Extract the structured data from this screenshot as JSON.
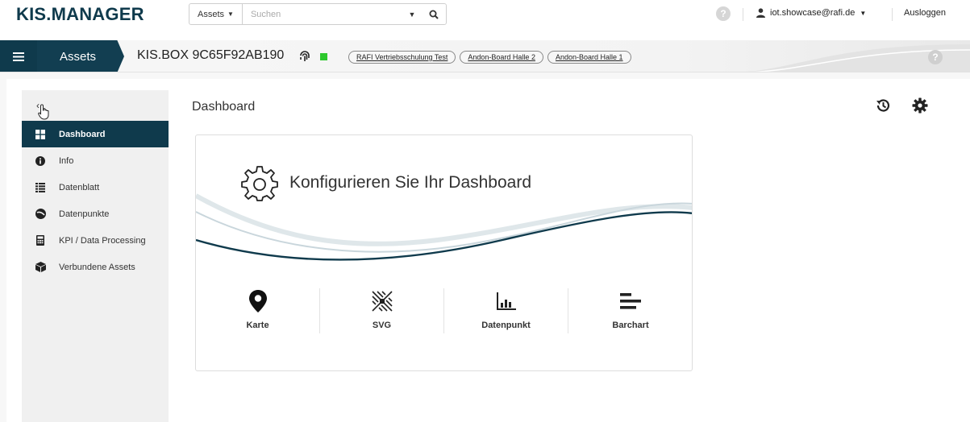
{
  "header": {
    "logo_part1": "KIS.",
    "logo_part2": "MANAGER",
    "search_type": "Assets",
    "search_placeholder": "Suchen",
    "help_label": "?",
    "user_email": "iot.showcase@rafi.de",
    "logout_label": "Ausloggen"
  },
  "assetbar": {
    "section_label": "Assets",
    "asset_name": "KIS.BOX 9C65F92AB190",
    "status_color": "#2dc82d",
    "tags": [
      "RAFI Vertriebsschulung Test",
      "Andon-Board Halle 2",
      "Andon-Board Halle 1"
    ],
    "help_label": "?"
  },
  "sidebar": {
    "collapse_label": "‹",
    "items": [
      {
        "label": "Dashboard",
        "icon": "grid-icon",
        "active": true
      },
      {
        "label": "Info",
        "icon": "info-icon"
      },
      {
        "label": "Datenblatt",
        "icon": "list-icon"
      },
      {
        "label": "Datenpunkte",
        "icon": "gauge-icon"
      },
      {
        "label": "KPI / Data Processing",
        "icon": "calculator-icon"
      },
      {
        "label": "Verbundene Assets",
        "icon": "cube-icon"
      }
    ]
  },
  "main": {
    "title": "Dashboard",
    "card_title": "Konfigurieren Sie Ihr Dashboard",
    "widgets": [
      {
        "label": "Karte",
        "icon": "map-pin-icon"
      },
      {
        "label": "SVG",
        "icon": "svg-icon"
      },
      {
        "label": "Datenpunkt",
        "icon": "bar-chart-icon"
      },
      {
        "label": "Barchart",
        "icon": "horizontal-bars-icon"
      }
    ]
  },
  "colors": {
    "primary": "#0f3a4c",
    "status_online": "#2dc82d"
  }
}
